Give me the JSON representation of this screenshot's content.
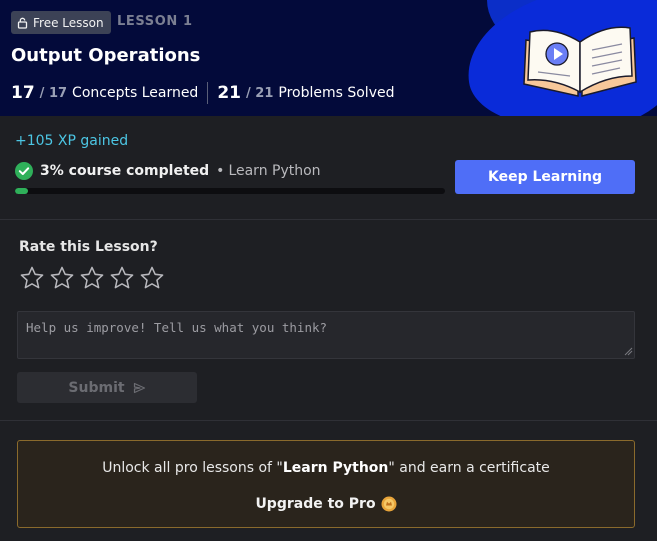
{
  "header": {
    "badge_label": "Free Lesson",
    "lesson_number": "LESSON 1",
    "title": "Output Operations",
    "concepts_done": "17",
    "concepts_total": "/ 17",
    "concepts_label": "Concepts Learned",
    "problems_done": "21",
    "problems_total": "/ 21",
    "problems_label": "Problems Solved"
  },
  "progress": {
    "xp_text": "+105 XP gained",
    "percent_text": "3% course completed",
    "bullet": "•",
    "course_name": "Learn Python",
    "fraction": 0.03,
    "keep_button": "Keep Learning"
  },
  "rating": {
    "label": "Rate this Lesson?",
    "star_count": 5,
    "stars_selected": 0
  },
  "feedback": {
    "placeholder": "Help us improve! Tell us what you think?",
    "value": ""
  },
  "submit": {
    "label": "Submit"
  },
  "pro": {
    "text_before": "Unlock all pro lessons of \"",
    "course": "Learn Python",
    "text_after": "\" and earn a certificate",
    "upgrade_label": "Upgrade to Pro"
  },
  "colors": {
    "header_bg": "#030a3a",
    "accent_blue": "#4f6ef7",
    "xp_cyan": "#4cc6e4",
    "success_green": "#2fb05a",
    "pro_border": "#8a6a2c"
  },
  "icons": {
    "badge": "lock-icon",
    "book": "open-book-video-icon",
    "completed": "check-circle-icon",
    "star": "star-outline-icon",
    "submit": "send-arrow-icon",
    "pro": "pro-coin-icon"
  }
}
